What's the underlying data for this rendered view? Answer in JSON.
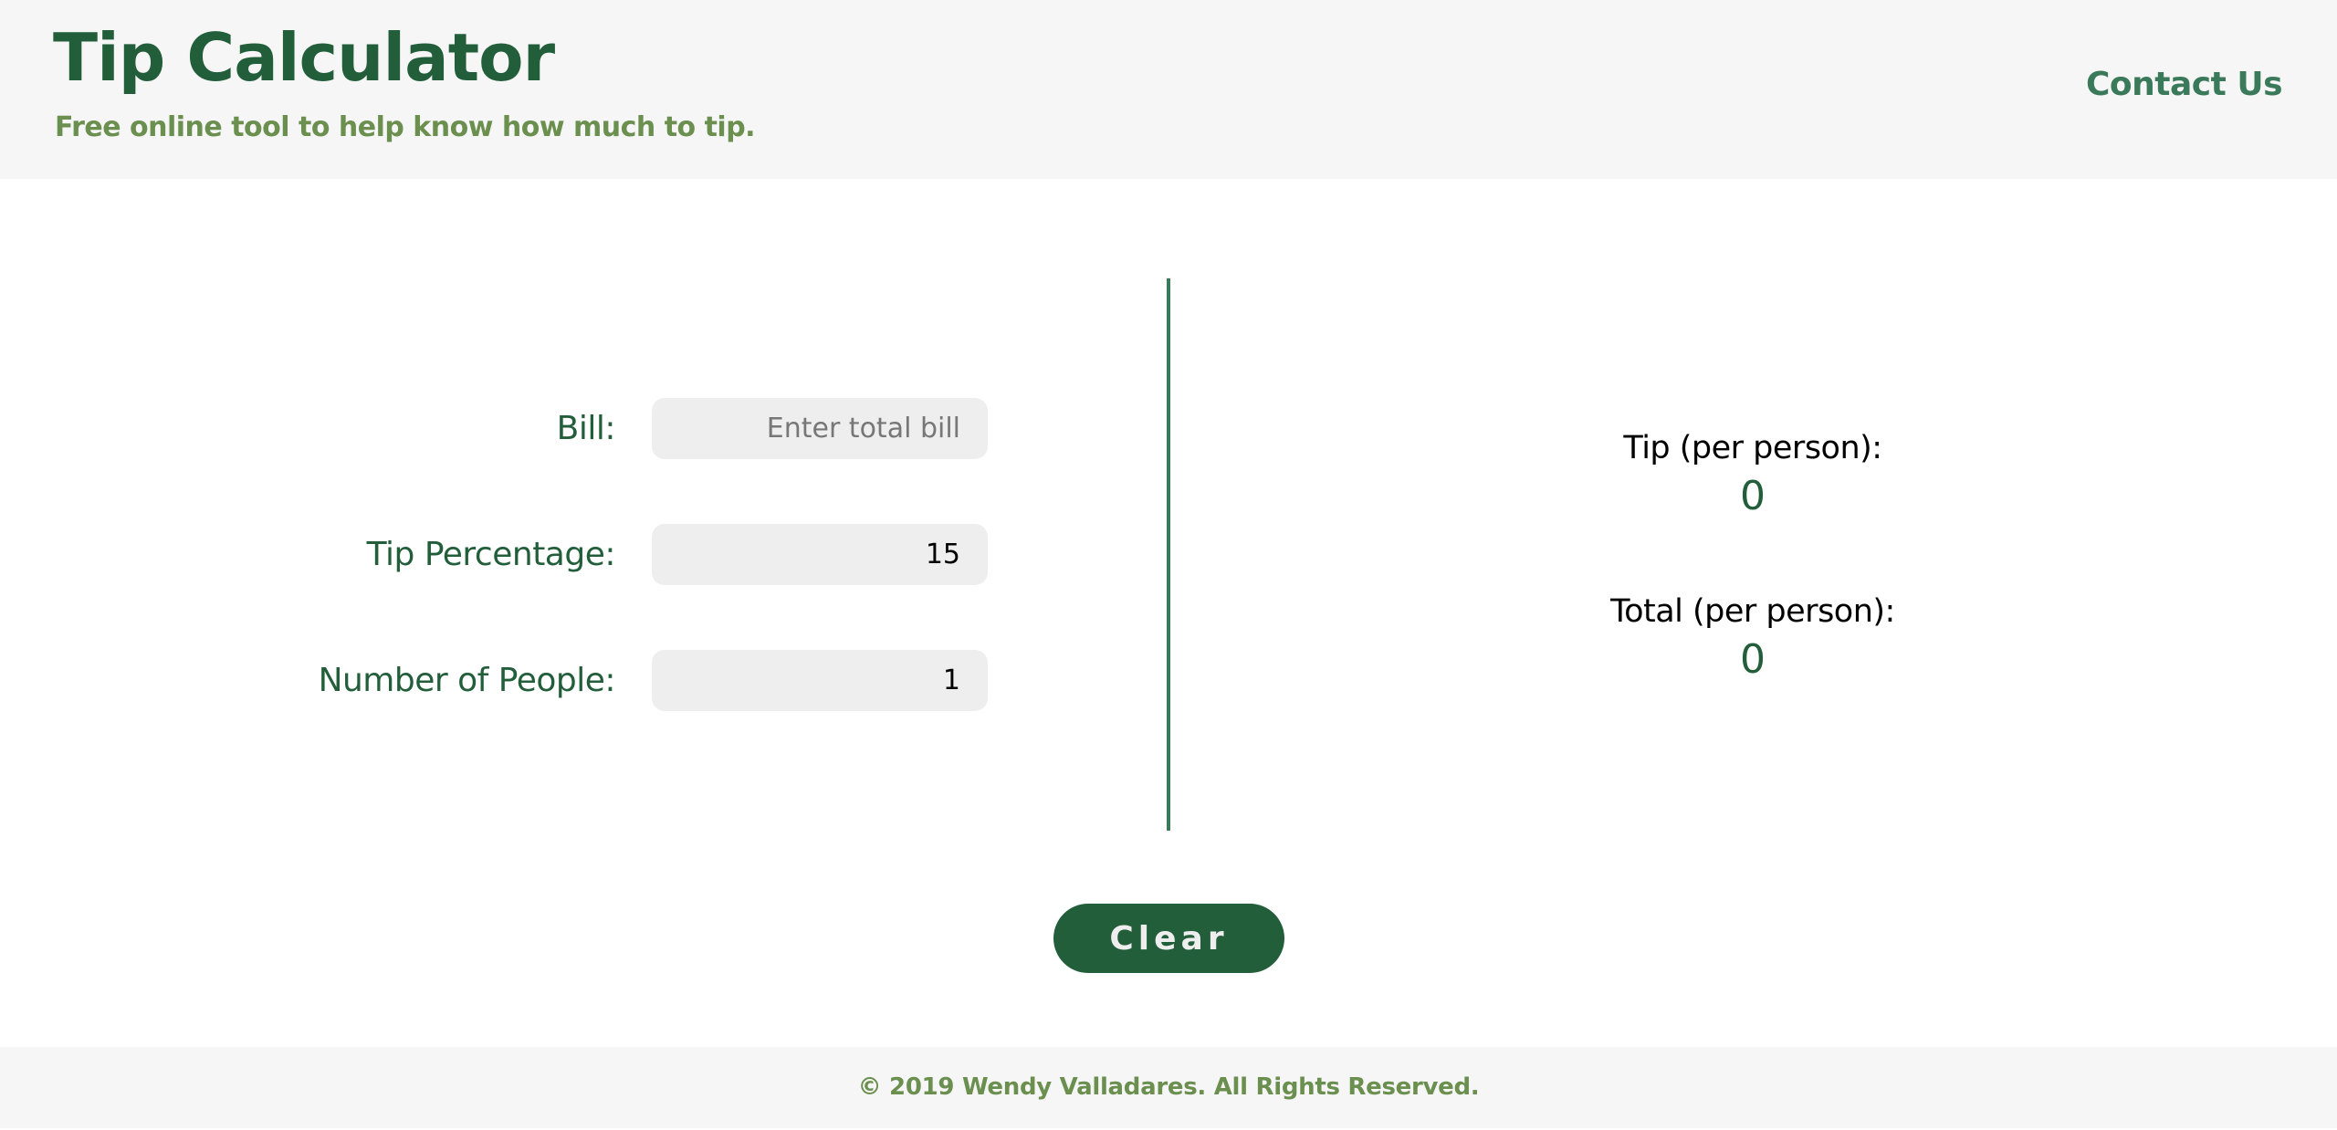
{
  "header": {
    "title": "Tip Calculator",
    "subtitle": "Free online tool to help know how much to tip.",
    "contact_link": "Contact Us"
  },
  "form": {
    "bill": {
      "label": "Bill:",
      "value": "",
      "placeholder": "Enter total bill"
    },
    "tip_percentage": {
      "label": "Tip Percentage:",
      "value": "15",
      "placeholder": ""
    },
    "num_people": {
      "label": "Number of People:",
      "value": "1",
      "placeholder": ""
    }
  },
  "results": {
    "tip": {
      "label": "Tip (per person):",
      "value": "0"
    },
    "total": {
      "label": "Total (per person):",
      "value": "0"
    }
  },
  "actions": {
    "clear_label": "Clear"
  },
  "footer": {
    "copyright": "© 2019 Wendy Valladares. All Rights Reserved."
  },
  "colors": {
    "primary": "#235e3b",
    "accent": "#3a7a5a",
    "secondary": "#6b8f4e",
    "header_bg": "#f6f6f6",
    "input_bg": "#eeeeee"
  }
}
